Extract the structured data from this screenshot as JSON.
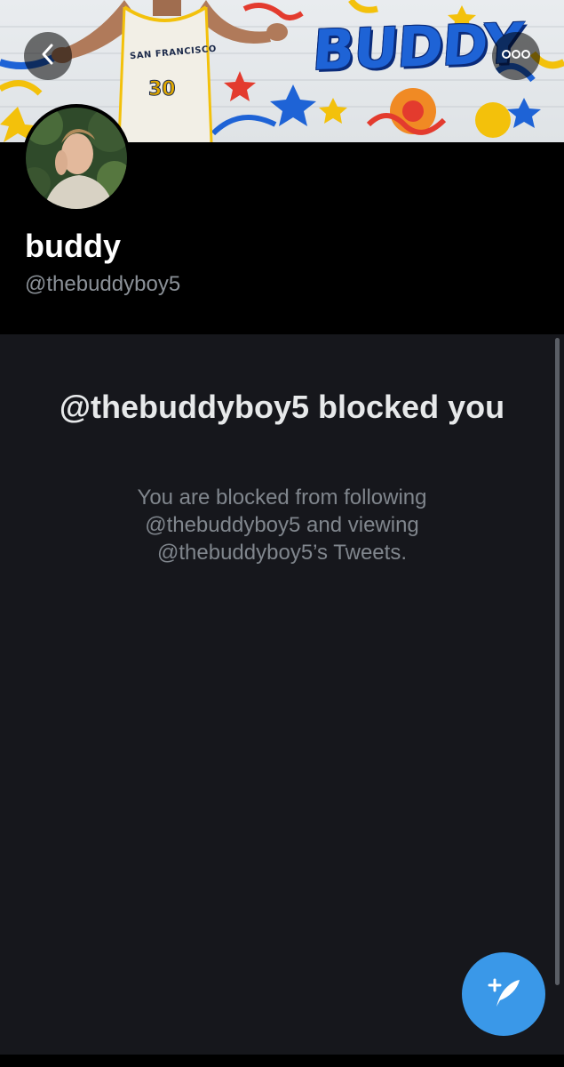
{
  "banner": {
    "text": "BUDDY",
    "jersey_city": "SAN FRANCISCO",
    "jersey_number": "30"
  },
  "profile": {
    "display_name": "buddy",
    "handle": "@thebuddyboy5"
  },
  "blocked": {
    "title": "@thebuddyboy5 blocked you",
    "description": "You are blocked from following @thebuddyboy5 and viewing @thebuddyboy5’s Tweets."
  },
  "icons": {
    "back": "chevron-left-icon",
    "more": "more-horizontal-icon",
    "compose": "compose-tweet-icon"
  },
  "colors": {
    "accent": "#3a98e8",
    "background": "#16171c",
    "header": "#000000"
  }
}
